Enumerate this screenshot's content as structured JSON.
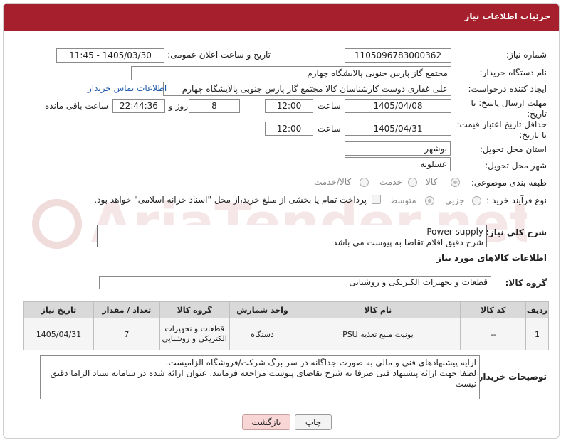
{
  "header": {
    "title": "جزئیات اطلاعات نیاز"
  },
  "form": {
    "need_number_label": "شماره نیاز:",
    "need_number": "1105096783000362",
    "announce_label": "تاریخ و ساعت اعلان عمومی:",
    "announce_value": "1405/03/30 - 11:45",
    "buyer_org_label": "نام دستگاه خریدار:",
    "buyer_org": "مجتمع گاز پارس جنوبی  پالایشگاه چهارم",
    "requester_label": "ایجاد کننده درخواست:",
    "requester": "علی غفاری دوست کارشناسان کالا مجتمع گاز پارس جنوبی  پالایشگاه چهارم",
    "contact_link": "اطلاعات تماس خریدار",
    "deadline_label_1": "مهلت ارسال پاسخ: تا",
    "deadline_label_2": "تاریخ:",
    "deadline_date": "1405/04/08",
    "time_label": "ساعت",
    "deadline_time": "12:00",
    "days_value": "8",
    "days_label": "روز و",
    "remaining_time": "22:44:36",
    "remaining_label": "ساعت باقی مانده",
    "price_validity_label_1": "حداقل تاریخ اعتبار قیمت:",
    "price_validity_label_2": "تا تاریخ:",
    "price_validity_date": "1405/04/31",
    "price_validity_time": "12:00",
    "province_label": "استان محل تحویل:",
    "province": "بوشهر",
    "city_label": "شهر محل تحویل:",
    "city": "عسلویه",
    "category_label": "طبقه بندی موضوعی:",
    "category_options": [
      "کالا",
      "خدمت",
      "کالا/خدمت"
    ],
    "purchase_type_label": "نوع فرآیند خرید :",
    "purchase_options": [
      "جزیی",
      "متوسط"
    ],
    "payment_note": "پرداخت تمام یا بخشی از مبلغ خرید،از محل \"اسناد خزانه اسلامی\" خواهد بود."
  },
  "description": {
    "label": "شرح کلی نیاز:",
    "line1": "Power supply",
    "line2": "شرح دقیق اقلام تقاضا به پیوست می باشد"
  },
  "goods_info": {
    "title": "اطلاعات کالاهای مورد نیاز"
  },
  "goods_group": {
    "label": "گروه کالا:",
    "value": "قطعات و تجهیزات الکتریکی و روشنایی"
  },
  "table": {
    "headers": [
      "ردیف",
      "کد کالا",
      "نام کالا",
      "واحد شمارش",
      "گروه کالا",
      "تعداد / مقدار",
      "تاریخ نیاز"
    ],
    "rows": [
      {
        "row": "1",
        "code": "--",
        "name": "یونیت منبع تغذیه PSU",
        "unit": "دستگاه",
        "group": "قطعات و تجهیزات الکتریکی و روشنایی",
        "qty": "7",
        "date": "1405/04/31"
      }
    ]
  },
  "buyer_notes": {
    "label": "توضیحات خریدار:",
    "line1": "ارایه پیشنهادهای فنی و مالی به صورت جداگانه در سر برگ شرکت/فروشگاه الزامیست.",
    "line2": "لطفا جهت ارائه پیشنهاد فنی صرفا به شرح تقاضای پیوست مراجعه فرمایید. عنوان ارائه شده در سامانه ستاد الزاما دقیق نیست"
  },
  "buttons": {
    "print": "چاپ",
    "back": "بازگشت"
  },
  "colors": {
    "header_bg": "#a51f2d",
    "link": "#1a57a8",
    "back_button_bg": "#f9d6d6"
  }
}
